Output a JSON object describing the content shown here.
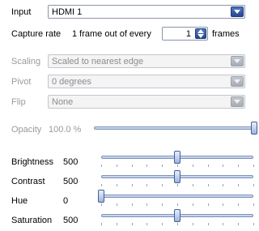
{
  "input": {
    "label": "Input",
    "value": "HDMI 1"
  },
  "capture": {
    "label": "Capture rate",
    "prefix": "1 frame out of every",
    "value": "1",
    "suffix": "frames"
  },
  "scaling": {
    "label": "Scaling",
    "value": "Scaled to nearest edge"
  },
  "pivot": {
    "label": "Pivot",
    "value": "0 degrees"
  },
  "flip": {
    "label": "Flip",
    "value": "None"
  },
  "opacity": {
    "label": "Opacity",
    "value_text": "100.0 %",
    "level": 1.0
  },
  "brightness": {
    "label": "Brightness",
    "value_text": "500",
    "level": 0.5
  },
  "contrast": {
    "label": "Contrast",
    "value_text": "500",
    "level": 0.5
  },
  "hue": {
    "label": "Hue",
    "value_text": "0",
    "level": 0.0
  },
  "saturation": {
    "label": "Saturation",
    "value_text": "500",
    "level": 0.5
  },
  "colors": {
    "accent": "#2f55a4",
    "disabled_text": "#9a9a9a"
  }
}
